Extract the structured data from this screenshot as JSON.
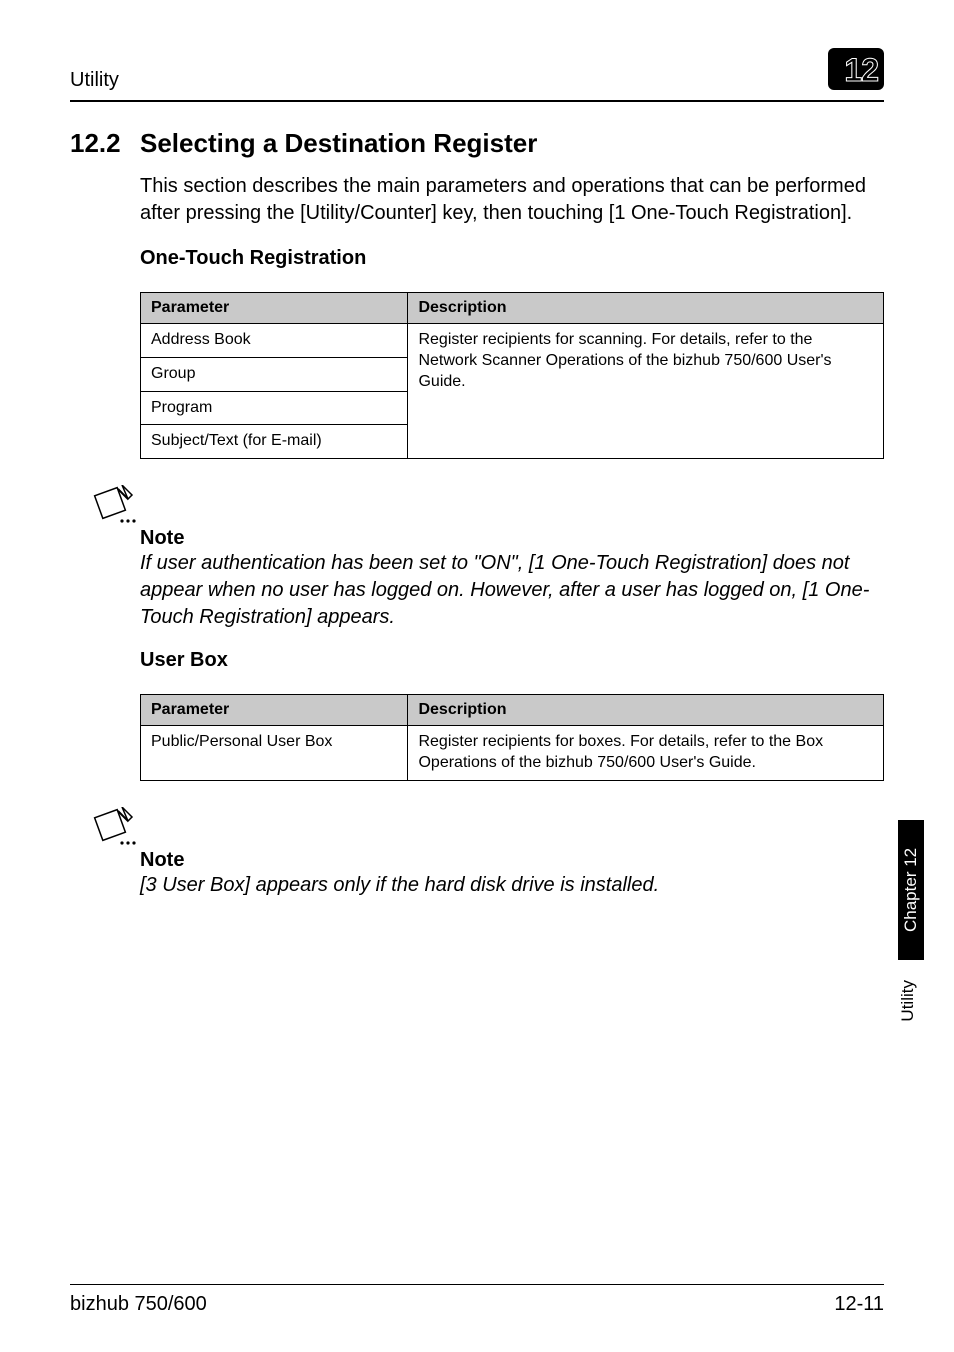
{
  "header": {
    "title": "Utility",
    "chapter_number": "12"
  },
  "section": {
    "number": "12.2",
    "title": "Selecting a Destination Register",
    "intro": "This section describes the main parameters and operations that can be performed after pressing the [Utility/Counter] key, then touching [1 One-Touch Registration]."
  },
  "one_touch": {
    "heading": "One-Touch Registration",
    "col_param": "Parameter",
    "col_desc": "Description",
    "rows": [
      "Address Book",
      "Group",
      "Program",
      "Subject/Text (for E-mail)"
    ],
    "desc": "Register recipients for scanning. For details, refer to the Network Scanner Operations of the bizhub 750/600 User's Guide."
  },
  "note1": {
    "label": "Note",
    "text": "If user authentication has been set to \"ON\", [1 One-Touch Registration] does not appear when no user has logged on. However, after a user has logged on, [1 One-Touch Registration] appears."
  },
  "user_box": {
    "heading": "User Box",
    "col_param": "Parameter",
    "col_desc": "Description",
    "row_param": "Public/Personal User Box",
    "row_desc": "Register recipients for boxes. For details, refer to the Box Operations of the bizhub 750/600 User's Guide."
  },
  "note2": {
    "label": "Note",
    "text": "[3 User Box] appears only if the hard disk drive is installed."
  },
  "side": {
    "tab": "Chapter 12",
    "label": "Utility"
  },
  "footer": {
    "left": "bizhub 750/600",
    "right": "12-11"
  },
  "icons": {
    "note_glyph": "✎…"
  }
}
